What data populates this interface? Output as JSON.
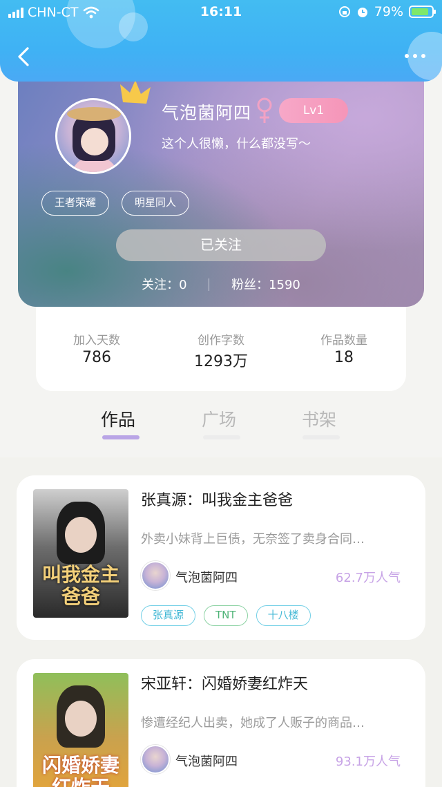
{
  "status_bar": {
    "carrier": "CHN-CT",
    "time": "16:11",
    "battery_percent": "79%"
  },
  "colors": {
    "header": "#3fb2f4",
    "level_badge": "#f595b8",
    "tab_indicator": "#b9a5e6",
    "popularity": "#c7a3e6"
  },
  "nav": {
    "back_icon": "chevron-left-icon",
    "more_icon": "more-dots-icon"
  },
  "profile": {
    "username": "气泡菌阿四",
    "gender_icon": "female-icon",
    "level": "Lv1",
    "bio": "这个人很懒，什么都没写～",
    "tags": [
      "王者荣耀",
      "明星同人"
    ],
    "follow_button": "已关注",
    "following": "关注：0",
    "fans": "粉丝：1590"
  },
  "stats": [
    {
      "label": "加入天数",
      "value": "786"
    },
    {
      "label": "创作字数",
      "value": "1293万"
    },
    {
      "label": "作品数量",
      "value": "18"
    }
  ],
  "tabs": [
    {
      "label": "作品",
      "active": true
    },
    {
      "label": "广场",
      "active": false
    },
    {
      "label": "书架",
      "active": false
    }
  ],
  "books": [
    {
      "title": "张真源：叫我金主爸爸",
      "description": "外卖小妹背上巨债，无奈签了卖身合同…",
      "author": "气泡菌阿四",
      "popularity": "62.7万人气",
      "cover_text": "叫我金主爸爸",
      "tags": [
        "张真源",
        "TNT",
        "十八楼"
      ]
    },
    {
      "title": "宋亚轩：闪婚娇妻红炸天",
      "description": "惨遭经纪人出卖，她成了人贩子的商品…",
      "author": "气泡菌阿四",
      "popularity": "93.1万人气",
      "cover_text": "闪婚娇妻红炸天",
      "tags": []
    }
  ]
}
